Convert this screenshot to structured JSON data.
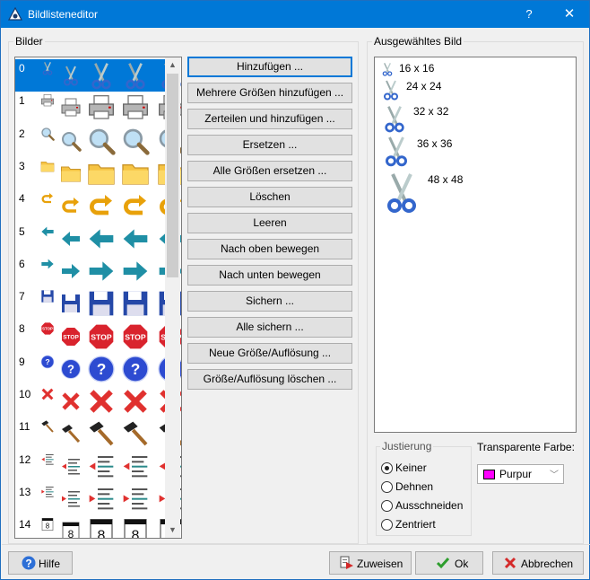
{
  "window": {
    "title": "Bildlisteneditor",
    "help_symbol": "?",
    "close_symbol": "✕"
  },
  "images_group": {
    "label": "Bilder"
  },
  "image_list": {
    "indices": [
      "0",
      "1",
      "2",
      "3",
      "4",
      "5",
      "6",
      "7",
      "8",
      "9",
      "10",
      "11",
      "12",
      "13",
      "14"
    ],
    "icon_types": [
      "scissors-icon",
      "printer-icon",
      "magnifier-icon",
      "folder-icon",
      "undo-arrow-icon",
      "left-arrow-icon",
      "right-arrow-icon",
      "floppy-disk-icon",
      "stop-sign-icon",
      "help-circle-icon",
      "red-x-icon",
      "hammer-icon",
      "outdent-list-icon",
      "indent-list-icon",
      "calendar-8-icon"
    ],
    "selected_index": "0",
    "stop_text": "STOP",
    "calendar_text": "8"
  },
  "actions": {
    "add": "Hinzufügen ...",
    "add_multiple": "Mehrere Größen hinzufügen ...",
    "split_add": "Zerteilen und hinzufügen ...",
    "replace": "Ersetzen ...",
    "replace_all": "Alle Größen ersetzen ...",
    "delete": "Löschen",
    "clear": "Leeren",
    "move_up": "Nach oben bewegen",
    "move_down": "Nach unten bewegen",
    "save": "Sichern ...",
    "save_all": "Alle sichern ...",
    "new_size": "Neue Größe/Auflösung ...",
    "delete_size": "Größe/Auflösung löschen ..."
  },
  "selected_image": {
    "label": "Ausgewähltes Bild",
    "sizes": [
      "16 x 16",
      "24 x 24",
      "32 x 32",
      "36 x 36",
      "48 x 48"
    ]
  },
  "alignment": {
    "label": "Justierung",
    "options": [
      "Keiner",
      "Dehnen",
      "Ausschneiden",
      "Zentriert"
    ],
    "selected": "Keiner"
  },
  "transparent_color": {
    "label": "Transparente Farbe:",
    "value": "Purpur",
    "swatch_color": "#ff00ff"
  },
  "footer": {
    "help": "Hilfe",
    "assign": "Zuweisen",
    "ok": "Ok",
    "cancel": "Abbrechen"
  },
  "colors": {
    "accent": "#0078d7",
    "titlebar": "#0078d7",
    "ok_check": "#2e9e2e",
    "cancel_x": "#d42a2a"
  }
}
